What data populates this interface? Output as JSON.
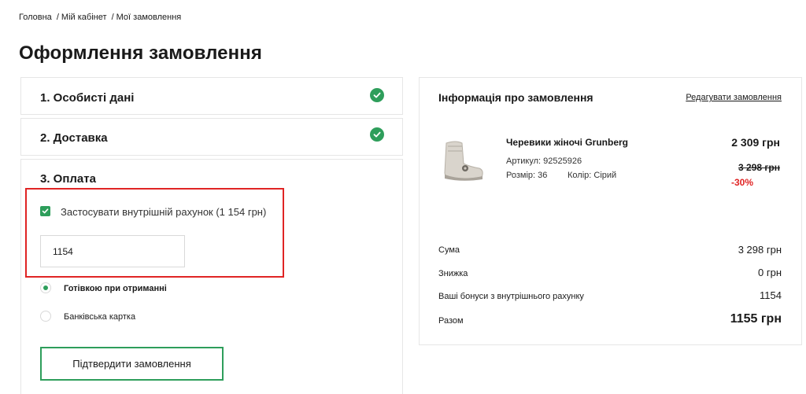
{
  "breadcrumb": {
    "home": "Головна",
    "cabinet": "Мій кабінет",
    "orders": "Мої замовлення",
    "separator": "/"
  },
  "page_title": "Оформлення замовлення",
  "steps": {
    "personal": {
      "title": "1. Особисті дані",
      "completed": true
    },
    "delivery": {
      "title": "2. Доставка",
      "completed": true
    },
    "payment": {
      "title": "3. Оплата"
    }
  },
  "payment": {
    "apply_balance_label": "Застосувати внутрішній рахунок (1 154 грн)",
    "apply_balance_checked": true,
    "balance_input_value": "1154",
    "options": [
      {
        "label": "Готівкою при отриманні",
        "selected": true
      },
      {
        "label": "Банківська картка",
        "selected": false
      }
    ],
    "confirm_label": "Підтвердити замовлення"
  },
  "summary": {
    "title": "Інформація про замовлення",
    "edit_link": "Редагувати замовлення",
    "product": {
      "name": "Черевики жіночі Grunberg",
      "article": "Артикул: 92525926",
      "size": "Розмір: 36",
      "color": "Колір: Сірий",
      "price": "2 309 грн",
      "old_price": "3 298 грн",
      "discount": "-30%"
    },
    "rows": {
      "sum": {
        "label": "Сума",
        "value": "3 298 грн"
      },
      "discount": {
        "label": "Знижка",
        "value": "0 грн"
      },
      "bonus": {
        "label": "Ваші бонуси з внутрішнього рахунку",
        "value": "1154"
      },
      "total": {
        "label": "Разом",
        "value": "1155 грн"
      }
    }
  },
  "colors": {
    "accent": "#2e9e5b",
    "highlight": "#e02424",
    "discount": "#e02424"
  },
  "icons": {
    "check": "check-circle-icon",
    "checkbox": "checkbox-checked-icon"
  }
}
